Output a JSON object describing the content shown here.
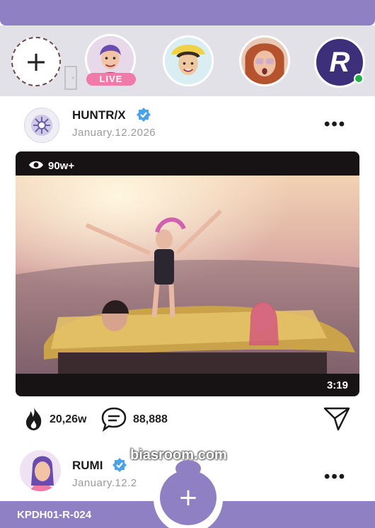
{
  "stories": {
    "add_label": "+",
    "live_badge": "LIVE",
    "brand_initial": "R"
  },
  "post": {
    "author": "HUNTR/X",
    "date": "January.12.2026",
    "more": "•••",
    "views": "90w+",
    "duration": "3:19",
    "likes": "20,26w",
    "comments": "88,888"
  },
  "post2": {
    "author": "RUMI",
    "date": "January.12.2",
    "more": "•••"
  },
  "footer": {
    "code": "KPDH01-R-024",
    "fab_label": "+",
    "watermark": "biasroom.com"
  },
  "colors": {
    "accent": "#8f7fc3",
    "verified": "#4aa3e8",
    "online": "#22b04a",
    "live": "#f07aa9"
  }
}
